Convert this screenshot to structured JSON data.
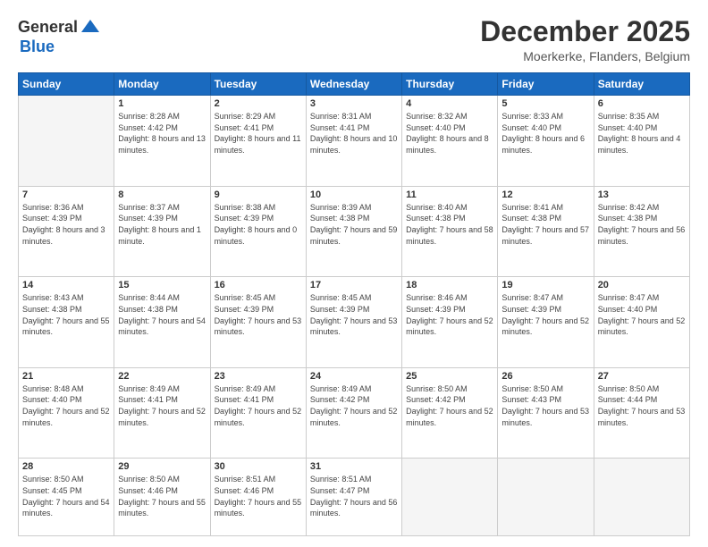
{
  "header": {
    "logo_general": "General",
    "logo_blue": "Blue",
    "month_title": "December 2025",
    "subtitle": "Moerkerke, Flanders, Belgium"
  },
  "weekdays": [
    "Sunday",
    "Monday",
    "Tuesday",
    "Wednesday",
    "Thursday",
    "Friday",
    "Saturday"
  ],
  "weeks": [
    [
      {
        "day": "",
        "empty": true
      },
      {
        "day": "1",
        "sunrise": "Sunrise: 8:28 AM",
        "sunset": "Sunset: 4:42 PM",
        "daylight": "Daylight: 8 hours and 13 minutes."
      },
      {
        "day": "2",
        "sunrise": "Sunrise: 8:29 AM",
        "sunset": "Sunset: 4:41 PM",
        "daylight": "Daylight: 8 hours and 11 minutes."
      },
      {
        "day": "3",
        "sunrise": "Sunrise: 8:31 AM",
        "sunset": "Sunset: 4:41 PM",
        "daylight": "Daylight: 8 hours and 10 minutes."
      },
      {
        "day": "4",
        "sunrise": "Sunrise: 8:32 AM",
        "sunset": "Sunset: 4:40 PM",
        "daylight": "Daylight: 8 hours and 8 minutes."
      },
      {
        "day": "5",
        "sunrise": "Sunrise: 8:33 AM",
        "sunset": "Sunset: 4:40 PM",
        "daylight": "Daylight: 8 hours and 6 minutes."
      },
      {
        "day": "6",
        "sunrise": "Sunrise: 8:35 AM",
        "sunset": "Sunset: 4:40 PM",
        "daylight": "Daylight: 8 hours and 4 minutes."
      }
    ],
    [
      {
        "day": "7",
        "sunrise": "Sunrise: 8:36 AM",
        "sunset": "Sunset: 4:39 PM",
        "daylight": "Daylight: 8 hours and 3 minutes."
      },
      {
        "day": "8",
        "sunrise": "Sunrise: 8:37 AM",
        "sunset": "Sunset: 4:39 PM",
        "daylight": "Daylight: 8 hours and 1 minute."
      },
      {
        "day": "9",
        "sunrise": "Sunrise: 8:38 AM",
        "sunset": "Sunset: 4:39 PM",
        "daylight": "Daylight: 8 hours and 0 minutes."
      },
      {
        "day": "10",
        "sunrise": "Sunrise: 8:39 AM",
        "sunset": "Sunset: 4:38 PM",
        "daylight": "Daylight: 7 hours and 59 minutes."
      },
      {
        "day": "11",
        "sunrise": "Sunrise: 8:40 AM",
        "sunset": "Sunset: 4:38 PM",
        "daylight": "Daylight: 7 hours and 58 minutes."
      },
      {
        "day": "12",
        "sunrise": "Sunrise: 8:41 AM",
        "sunset": "Sunset: 4:38 PM",
        "daylight": "Daylight: 7 hours and 57 minutes."
      },
      {
        "day": "13",
        "sunrise": "Sunrise: 8:42 AM",
        "sunset": "Sunset: 4:38 PM",
        "daylight": "Daylight: 7 hours and 56 minutes."
      }
    ],
    [
      {
        "day": "14",
        "sunrise": "Sunrise: 8:43 AM",
        "sunset": "Sunset: 4:38 PM",
        "daylight": "Daylight: 7 hours and 55 minutes."
      },
      {
        "day": "15",
        "sunrise": "Sunrise: 8:44 AM",
        "sunset": "Sunset: 4:38 PM",
        "daylight": "Daylight: 7 hours and 54 minutes."
      },
      {
        "day": "16",
        "sunrise": "Sunrise: 8:45 AM",
        "sunset": "Sunset: 4:39 PM",
        "daylight": "Daylight: 7 hours and 53 minutes."
      },
      {
        "day": "17",
        "sunrise": "Sunrise: 8:45 AM",
        "sunset": "Sunset: 4:39 PM",
        "daylight": "Daylight: 7 hours and 53 minutes."
      },
      {
        "day": "18",
        "sunrise": "Sunrise: 8:46 AM",
        "sunset": "Sunset: 4:39 PM",
        "daylight": "Daylight: 7 hours and 52 minutes."
      },
      {
        "day": "19",
        "sunrise": "Sunrise: 8:47 AM",
        "sunset": "Sunset: 4:39 PM",
        "daylight": "Daylight: 7 hours and 52 minutes."
      },
      {
        "day": "20",
        "sunrise": "Sunrise: 8:47 AM",
        "sunset": "Sunset: 4:40 PM",
        "daylight": "Daylight: 7 hours and 52 minutes."
      }
    ],
    [
      {
        "day": "21",
        "sunrise": "Sunrise: 8:48 AM",
        "sunset": "Sunset: 4:40 PM",
        "daylight": "Daylight: 7 hours and 52 minutes."
      },
      {
        "day": "22",
        "sunrise": "Sunrise: 8:49 AM",
        "sunset": "Sunset: 4:41 PM",
        "daylight": "Daylight: 7 hours and 52 minutes."
      },
      {
        "day": "23",
        "sunrise": "Sunrise: 8:49 AM",
        "sunset": "Sunset: 4:41 PM",
        "daylight": "Daylight: 7 hours and 52 minutes."
      },
      {
        "day": "24",
        "sunrise": "Sunrise: 8:49 AM",
        "sunset": "Sunset: 4:42 PM",
        "daylight": "Daylight: 7 hours and 52 minutes."
      },
      {
        "day": "25",
        "sunrise": "Sunrise: 8:50 AM",
        "sunset": "Sunset: 4:42 PM",
        "daylight": "Daylight: 7 hours and 52 minutes."
      },
      {
        "day": "26",
        "sunrise": "Sunrise: 8:50 AM",
        "sunset": "Sunset: 4:43 PM",
        "daylight": "Daylight: 7 hours and 53 minutes."
      },
      {
        "day": "27",
        "sunrise": "Sunrise: 8:50 AM",
        "sunset": "Sunset: 4:44 PM",
        "daylight": "Daylight: 7 hours and 53 minutes."
      }
    ],
    [
      {
        "day": "28",
        "sunrise": "Sunrise: 8:50 AM",
        "sunset": "Sunset: 4:45 PM",
        "daylight": "Daylight: 7 hours and 54 minutes."
      },
      {
        "day": "29",
        "sunrise": "Sunrise: 8:50 AM",
        "sunset": "Sunset: 4:46 PM",
        "daylight": "Daylight: 7 hours and 55 minutes."
      },
      {
        "day": "30",
        "sunrise": "Sunrise: 8:51 AM",
        "sunset": "Sunset: 4:46 PM",
        "daylight": "Daylight: 7 hours and 55 minutes."
      },
      {
        "day": "31",
        "sunrise": "Sunrise: 8:51 AM",
        "sunset": "Sunset: 4:47 PM",
        "daylight": "Daylight: 7 hours and 56 minutes."
      },
      {
        "day": "",
        "empty": true
      },
      {
        "day": "",
        "empty": true
      },
      {
        "day": "",
        "empty": true
      }
    ]
  ]
}
